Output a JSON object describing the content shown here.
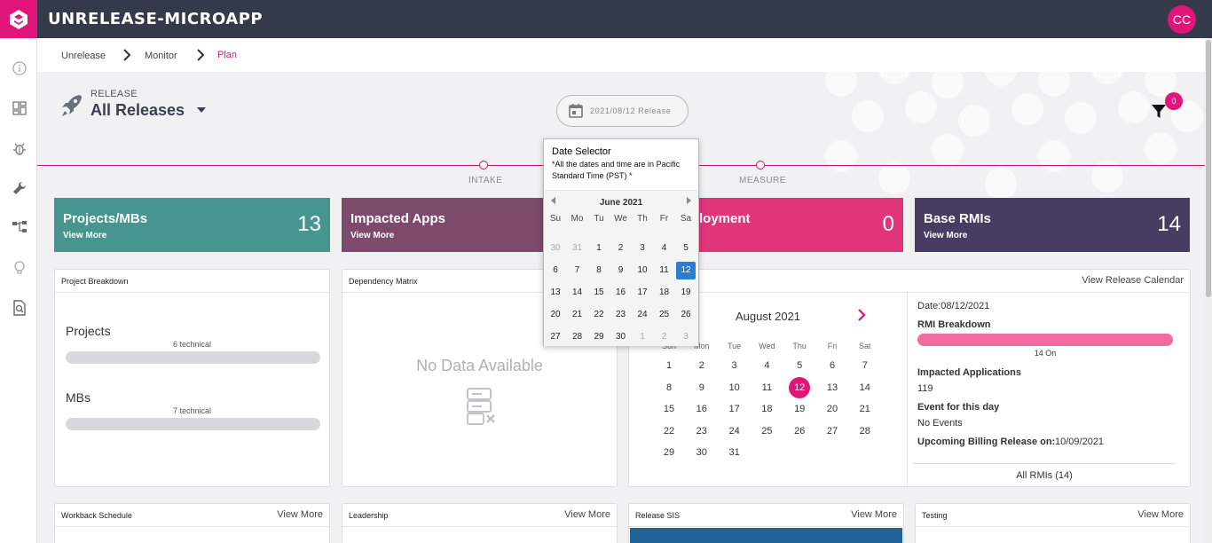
{
  "app": {
    "title": "UNRELEASE-MICROAPP",
    "avatar_initials": "CC",
    "brand_color": "#e0157a",
    "topbar_color": "#343a4a"
  },
  "sidebar": {
    "icons": [
      "info-icon",
      "dashboard-icon",
      "bug-icon",
      "wrench-icon",
      "hierarchy-icon",
      "lightbulb-icon",
      "search-document-icon"
    ]
  },
  "breadcrumb": [
    "Unrelease",
    "Monitor",
    "Plan"
  ],
  "release": {
    "label": "RELEASE",
    "value": "All Releases"
  },
  "date_pill": {
    "text": "2021/08/12 Release"
  },
  "filter": {
    "badge": "0"
  },
  "timeline": {
    "labels": [
      "INTAKE",
      "MEASURE"
    ]
  },
  "stats": [
    {
      "title": "Projects/MBs",
      "more": "View More",
      "value": "13",
      "color": "#46968f"
    },
    {
      "title": "Impacted Apps",
      "more": "View More",
      "value": "",
      "color": "#7d4a6c"
    },
    {
      "title": "Deployment",
      "visible_title": "loyment",
      "more": "",
      "value": "0",
      "color": "#e1357a"
    },
    {
      "title": "Base RMIs",
      "more": "View More",
      "value": "14",
      "color": "#483c62"
    }
  ],
  "project_breakdown": {
    "title": "Project Breakdown",
    "rows": [
      {
        "label": "Projects",
        "sub": "6 technical"
      },
      {
        "label": "MBs",
        "sub": "7 technical"
      }
    ]
  },
  "dependency_matrix": {
    "title": "Dependency Matrix",
    "empty": "No Data Available"
  },
  "release_calendar": {
    "link": "View Release Calendar",
    "month": "August 2021",
    "dow": [
      "Sun",
      "Mon",
      "Tue",
      "Wed",
      "Thu",
      "Fri",
      "Sat"
    ],
    "weeks": [
      [
        "1",
        "2",
        "3",
        "4",
        "5",
        "6",
        "7"
      ],
      [
        "8",
        "9",
        "10",
        "11",
        "12",
        "13",
        "14"
      ],
      [
        "15",
        "16",
        "17",
        "18",
        "19",
        "20",
        "21"
      ],
      [
        "22",
        "23",
        "24",
        "25",
        "26",
        "27",
        "28"
      ],
      [
        "29",
        "30",
        "31",
        "",
        "",
        "",
        ""
      ]
    ],
    "selected": "12",
    "date": "Date:08/12/2021",
    "rmi_breakdown_label": "RMI Breakdown",
    "rmi_bar_caption": "14 On",
    "impacted_label": "Impacted Applications",
    "impacted_value": "119",
    "event_label": "Event for this day",
    "event_value": "No Events",
    "billing_label": "Upcoming Billing Release on:",
    "billing_value": "10/09/2021",
    "all_rmis": "All RMIs (14)"
  },
  "bottom_panels": [
    {
      "title": "Workback Schedule",
      "link": "View More"
    },
    {
      "title": "Leadership",
      "link": "View More"
    },
    {
      "title": "Release SIS",
      "link": "View More"
    },
    {
      "title": "Testing",
      "link": "View More"
    }
  ],
  "date_selector": {
    "title": "Date Selector",
    "note": "*All the dates and time are in Pacific Standard Time (PST) *",
    "month": "June 2021",
    "dow": [
      "Su",
      "Mo",
      "Tu",
      "We",
      "Th",
      "Fr",
      "Sa"
    ],
    "weeks": [
      [
        "30",
        "31",
        "1",
        "2",
        "3",
        "4",
        "5"
      ],
      [
        "6",
        "7",
        "8",
        "9",
        "10",
        "11",
        "12"
      ],
      [
        "13",
        "14",
        "15",
        "16",
        "17",
        "18",
        "19"
      ],
      [
        "20",
        "21",
        "22",
        "23",
        "24",
        "25",
        "26"
      ],
      [
        "27",
        "28",
        "29",
        "30",
        "1",
        "2",
        "3"
      ]
    ],
    "selected": "12"
  }
}
